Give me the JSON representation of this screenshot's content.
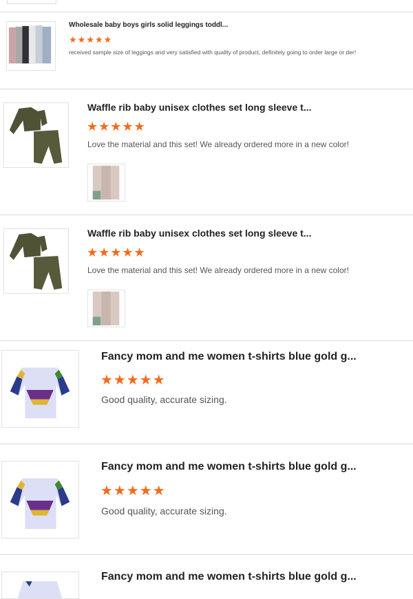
{
  "reviews": [
    {
      "title": "Wholesale baby boys girls solid leggings toddl...",
      "stars": "★★★★★",
      "text": "received sample size of leggings and very satisfied with quality of product, definitely going to order large or der!",
      "product_image": "leggings-image"
    },
    {
      "title": "Waffle rib baby unisex clothes set long sleeve t...",
      "stars": "★★★★★",
      "text": "Love the material and this set! We already ordered more in a new color!",
      "product_image": "olive-clothes-set-image"
    },
    {
      "title": "Waffle rib baby unisex clothes set long sleeve t...",
      "stars": "★★★★★",
      "text": "Love the material and this set! We already ordered more in a new color!",
      "product_image": "olive-clothes-set-image"
    },
    {
      "title": "Fancy mom and me women t-shirts blue gold g...",
      "stars": "★★★★★",
      "text": "Good quality, accurate sizing.",
      "product_image": "striped-tshirts-image"
    },
    {
      "title": "Fancy mom and me women t-shirts blue gold g...",
      "stars": "★★★★★",
      "text": "Good quality, accurate sizing.",
      "product_image": "striped-tshirts-image"
    },
    {
      "title": "Fancy mom and me women t-shirts blue gold g...",
      "stars": "",
      "text": "",
      "product_image": "striped-tshirts-image"
    }
  ],
  "colors": {
    "star": "#f56a1b",
    "divider": "#d9d9d9"
  }
}
